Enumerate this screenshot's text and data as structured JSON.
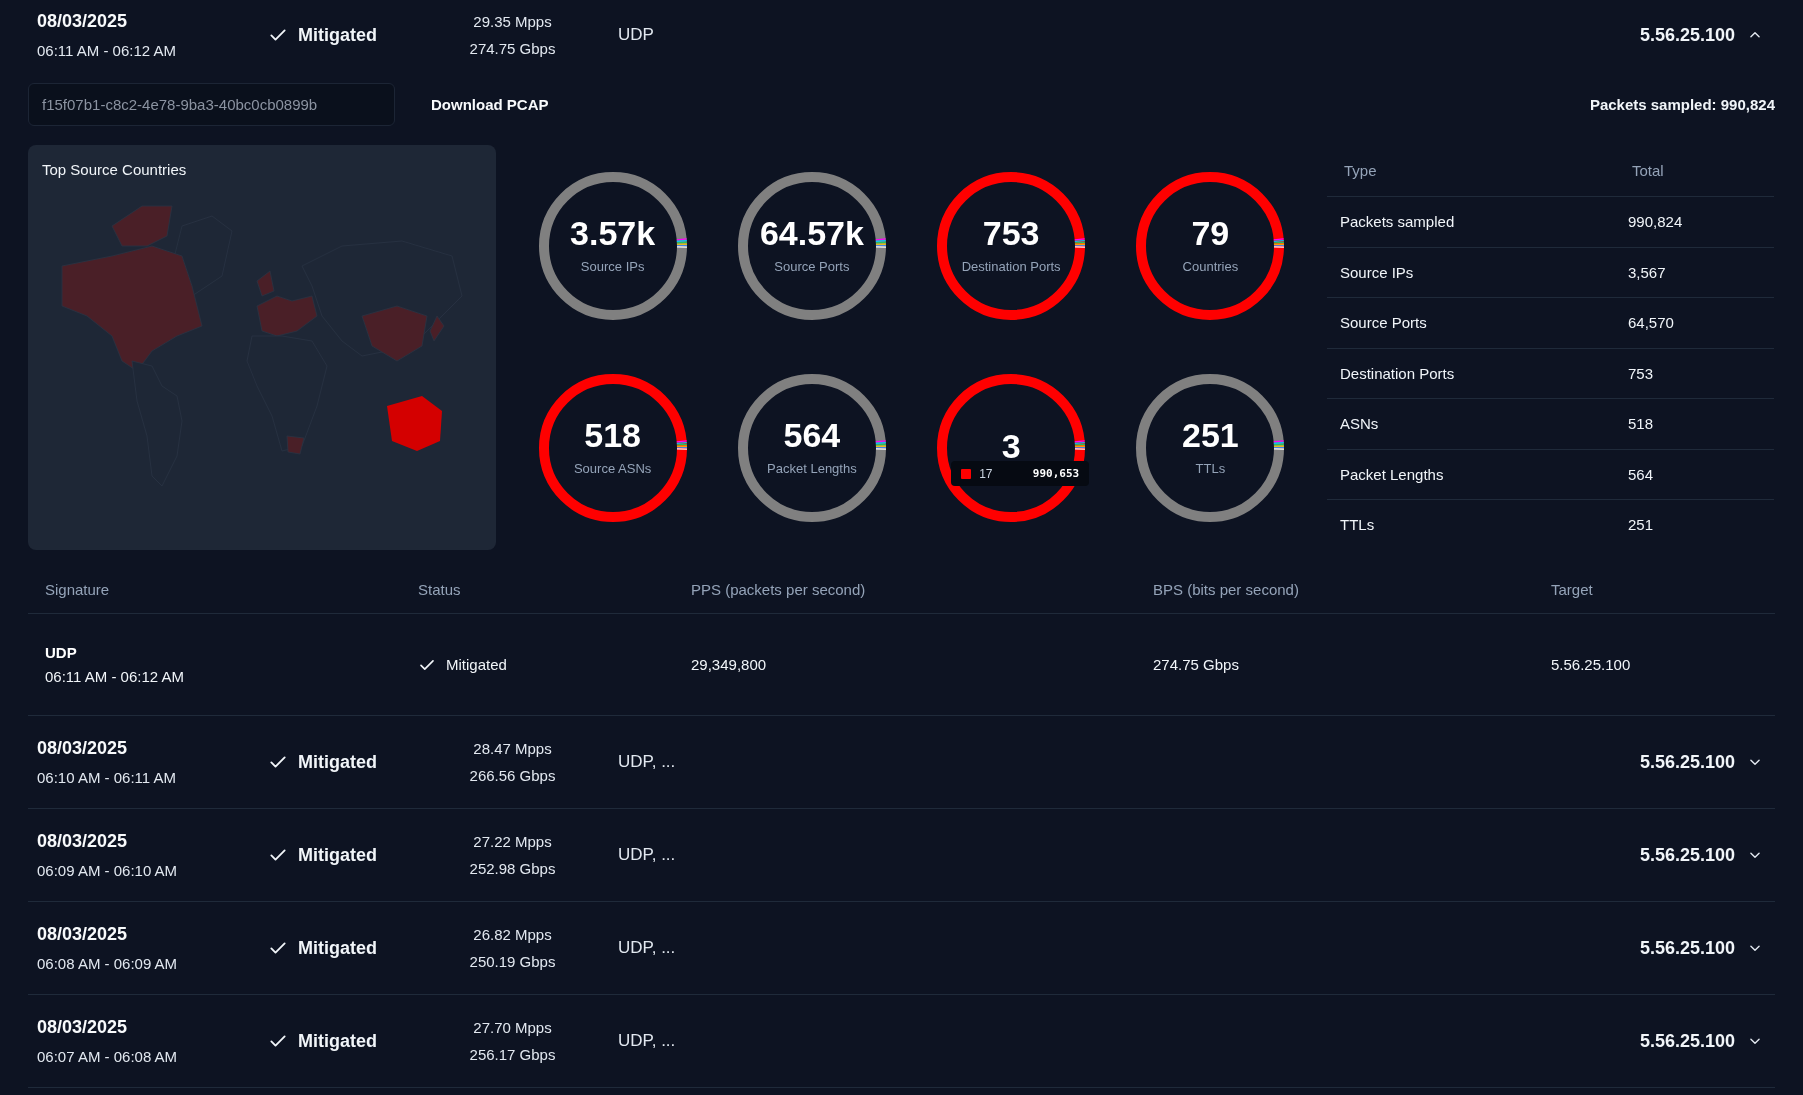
{
  "attacks": [
    {
      "date": "08/03/2025",
      "time": "06:11 AM - 06:12 AM",
      "status": "Mitigated",
      "pps": "29.35 Mpps",
      "bps": "274.75 Gbps",
      "signature": "UDP",
      "target": "5.56.25.100",
      "expanded": true,
      "details": {
        "attack_id": "f15f07b1-c8c2-4e78-9ba3-40bc0cb0899b",
        "download": "Download PCAP",
        "packets_sampled": "Packets sampled: 990,824",
        "map": {
          "title": "Top Source Countries"
        },
        "stats": [
          {
            "value": "3.57k",
            "label": "Source IPs",
            "color": "#808080"
          },
          {
            "value": "64.57k",
            "label": "Source Ports",
            "color": "#808080"
          },
          {
            "value": "753",
            "label": "Destination Ports",
            "color": "#ff0000"
          },
          {
            "value": "79",
            "label": "Countries",
            "color": "#ff0000"
          },
          {
            "value": "518",
            "label": "Source ASNs",
            "color": "#ff0000"
          },
          {
            "value": "564",
            "label": "Packet Lengths",
            "color": "#808080"
          },
          {
            "value": "3",
            "color": "#ff0000",
            "tooltip": {
              "label": "17",
              "value": "990,653",
              "color": "#ff0000"
            }
          },
          {
            "value": "251",
            "label": "TTLs",
            "color": "#808080"
          }
        ],
        "summary": {
          "columns": [
            "Type",
            "Total"
          ],
          "rows": [
            [
              "Packets sampled",
              "990,824"
            ],
            [
              "Source IPs",
              "3,567"
            ],
            [
              "Source Ports",
              "64,570"
            ],
            [
              "Destination Ports",
              "753"
            ],
            [
              "ASNs",
              "518"
            ],
            [
              "Packet Lengths",
              "564"
            ],
            [
              "TTLs",
              "251"
            ]
          ]
        },
        "signatures": {
          "columns": [
            "Signature",
            "Status",
            "PPS (packets per second)",
            "BPS (bits per second)",
            "Target"
          ],
          "rows": [
            {
              "signature": "UDP",
              "time": "06:11 AM - 06:12 AM",
              "status": "Mitigated",
              "pps": "29,349,800",
              "bps": "274.75 Gbps",
              "target": "5.56.25.100"
            }
          ]
        }
      }
    },
    {
      "date": "08/03/2025",
      "time": "06:10 AM - 06:11 AM",
      "status": "Mitigated",
      "pps": "28.47 Mpps",
      "bps": "266.56 Gbps",
      "signature": "UDP, ...",
      "target": "5.56.25.100",
      "expanded": false
    },
    {
      "date": "08/03/2025",
      "time": "06:09 AM - 06:10 AM",
      "status": "Mitigated",
      "pps": "27.22 Mpps",
      "bps": "252.98 Gbps",
      "signature": "UDP, ...",
      "target": "5.56.25.100",
      "expanded": false
    },
    {
      "date": "08/03/2025",
      "time": "06:08 AM - 06:09 AM",
      "status": "Mitigated",
      "pps": "26.82 Mpps",
      "bps": "250.19 Gbps",
      "signature": "UDP, ...",
      "target": "5.56.25.100",
      "expanded": false
    },
    {
      "date": "08/03/2025",
      "time": "06:07 AM - 06:08 AM",
      "status": "Mitigated",
      "pps": "27.70 Mpps",
      "bps": "256.17 Gbps",
      "signature": "UDP, ...",
      "target": "5.56.25.100",
      "expanded": false
    }
  ]
}
